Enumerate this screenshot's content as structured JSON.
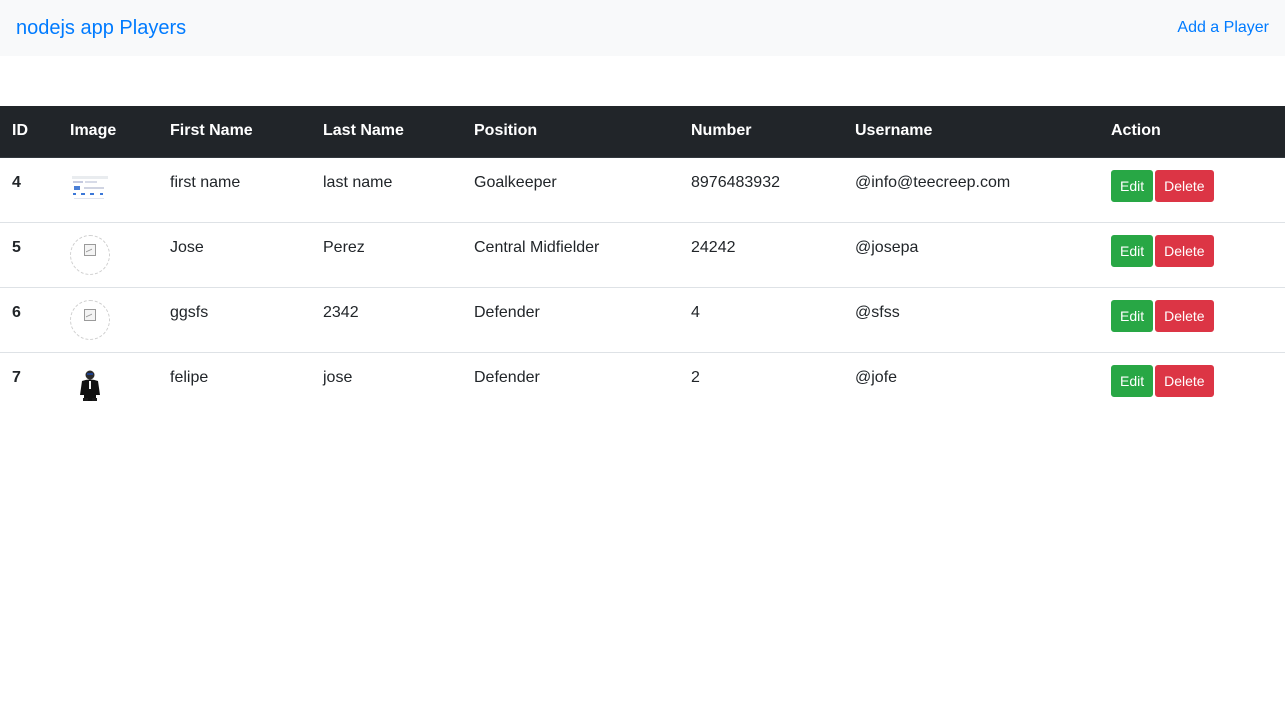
{
  "navbar": {
    "brand": "nodejs app Players",
    "add_link": "Add a Player",
    "brand_color": "#007bff",
    "background": "#f8f9fa"
  },
  "table": {
    "headers": [
      "ID",
      "Image",
      "First Name",
      "Last Name",
      "Position",
      "Number",
      "Username",
      "Action"
    ],
    "rows": [
      {
        "id": "4",
        "image": "screenshot-thumbnail",
        "first_name": "first name",
        "last_name": "last name",
        "position": "Goalkeeper",
        "number": "8976483932",
        "username": "@info@teecreep.com",
        "edit": "Edit",
        "delete": "Delete"
      },
      {
        "id": "5",
        "image": "broken-image-icon",
        "first_name": "Jose",
        "last_name": "Perez",
        "position": "Central Midfielder",
        "number": "24242",
        "username": "@josepa",
        "edit": "Edit",
        "delete": "Delete"
      },
      {
        "id": "6",
        "image": "broken-image-icon",
        "first_name": "ggsfs",
        "last_name": "2342",
        "position": "Defender",
        "number": "4",
        "username": "@sfss",
        "edit": "Edit",
        "delete": "Delete"
      },
      {
        "id": "7",
        "image": "person-photo",
        "first_name": "felipe",
        "last_name": "jose",
        "position": "Defender",
        "number": "2",
        "username": "@jofe",
        "edit": "Edit",
        "delete": "Delete"
      }
    ]
  },
  "colors": {
    "header_bg": "#212529",
    "edit_button": "#28a745",
    "delete_button": "#dc3545"
  }
}
